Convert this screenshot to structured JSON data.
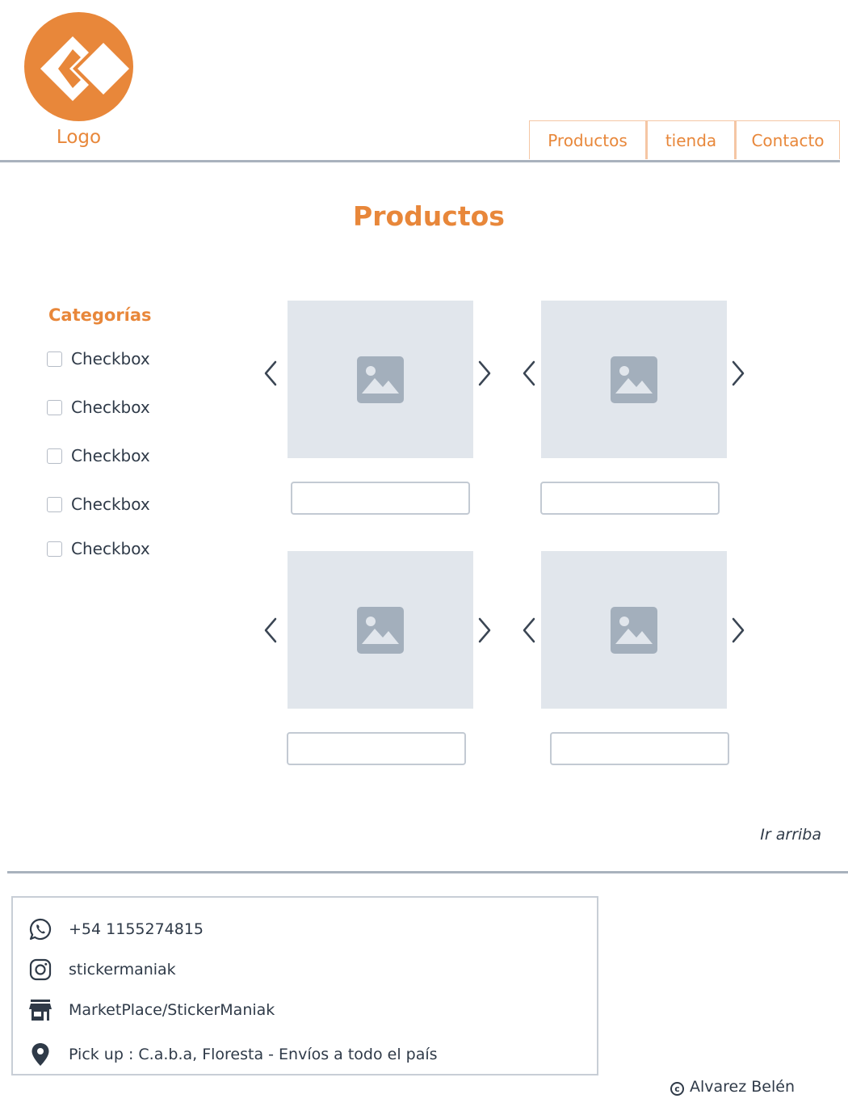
{
  "header": {
    "logo_label": "Logo",
    "nav": [
      {
        "label": "Productos"
      },
      {
        "label": "tienda"
      },
      {
        "label": "Contacto"
      }
    ]
  },
  "main": {
    "title": "Productos",
    "categories": {
      "title": "Categorías",
      "items": [
        {
          "label": "Checkbox",
          "checked": false
        },
        {
          "label": "Checkbox",
          "checked": false
        },
        {
          "label": "Checkbox",
          "checked": false
        },
        {
          "label": "Checkbox",
          "checked": false
        },
        {
          "label": "Checkbox",
          "checked": false
        }
      ]
    },
    "products": [
      {
        "image_icon": "image-placeholder-icon",
        "field_value": ""
      },
      {
        "image_icon": "image-placeholder-icon",
        "field_value": ""
      },
      {
        "image_icon": "image-placeholder-icon",
        "field_value": ""
      },
      {
        "image_icon": "image-placeholder-icon",
        "field_value": ""
      }
    ]
  },
  "footer": {
    "go_top_label": "Ir arriba",
    "contacts": [
      {
        "icon": "whatsapp-icon",
        "text": "+54 1155274815"
      },
      {
        "icon": "instagram-icon",
        "text": "stickermaniak"
      },
      {
        "icon": "store-icon",
        "text": "MarketPlace/StickerManiak"
      },
      {
        "icon": "location-pin-icon",
        "text": "Pick up : C.a.b.a, Floresta - Envíos a todo el país"
      }
    ],
    "copyright": "Alvarez Belén"
  },
  "colors": {
    "accent": "#e8873a",
    "text": "#2f3a48",
    "placeholder_bg": "#e1e6ec",
    "placeholder_icon": "#a3afbc",
    "border": "#c3cad3"
  }
}
